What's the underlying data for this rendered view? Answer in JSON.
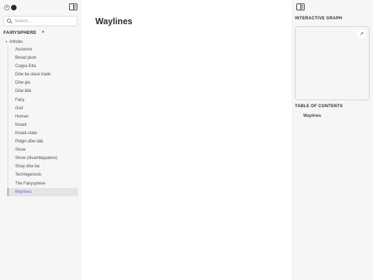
{
  "left_sidebar": {
    "search": {
      "placeholder": "Search..."
    },
    "site_title": "FAIRYSPHERE",
    "folder": {
      "label": "Articles"
    },
    "items": [
      {
        "label": "Ascience",
        "active": false
      },
      {
        "label": "Bread plum",
        "active": false
      },
      {
        "label": "Coppa Etta",
        "active": false
      },
      {
        "label": "Dōw ba slave trade",
        "active": false
      },
      {
        "label": "Dōw gia",
        "active": false
      },
      {
        "label": "Dōw lālā",
        "active": false
      },
      {
        "label": "Fairy",
        "active": false
      },
      {
        "label": "God",
        "active": false
      },
      {
        "label": "Human",
        "active": false
      },
      {
        "label": "Knack",
        "active": false
      },
      {
        "label": "Knack-state",
        "active": false
      },
      {
        "label": "Pidgin dōw lālā",
        "active": false
      },
      {
        "label": "Show",
        "active": false
      },
      {
        "label": "Show (disambiguation)",
        "active": false
      },
      {
        "label": "Stray dōw ba",
        "active": false
      },
      {
        "label": "Technigenesis",
        "active": false
      },
      {
        "label": "The Fairysphere",
        "active": false
      },
      {
        "label": "Waylines",
        "active": true
      }
    ]
  },
  "main": {
    "title": "Waylines"
  },
  "right_sidebar": {
    "graph_heading": "INTERACTIVE GRAPH",
    "toc_heading": "TABLE OF CONTENTS",
    "toc_items": [
      {
        "label": "Waylines"
      }
    ]
  },
  "colors": {
    "accent": "#7a5fd0",
    "sidebar_bg": "#f6f6f6",
    "active_bg": "#e4e4e4"
  },
  "icons": {
    "theme_toggle": "sun-moon-icon",
    "panel": "sidebar-panel-icon",
    "search": "search-icon",
    "collapse": "collapse-icon",
    "chevron": "chevron-down-icon",
    "expand": "arrow-up-right-icon"
  }
}
